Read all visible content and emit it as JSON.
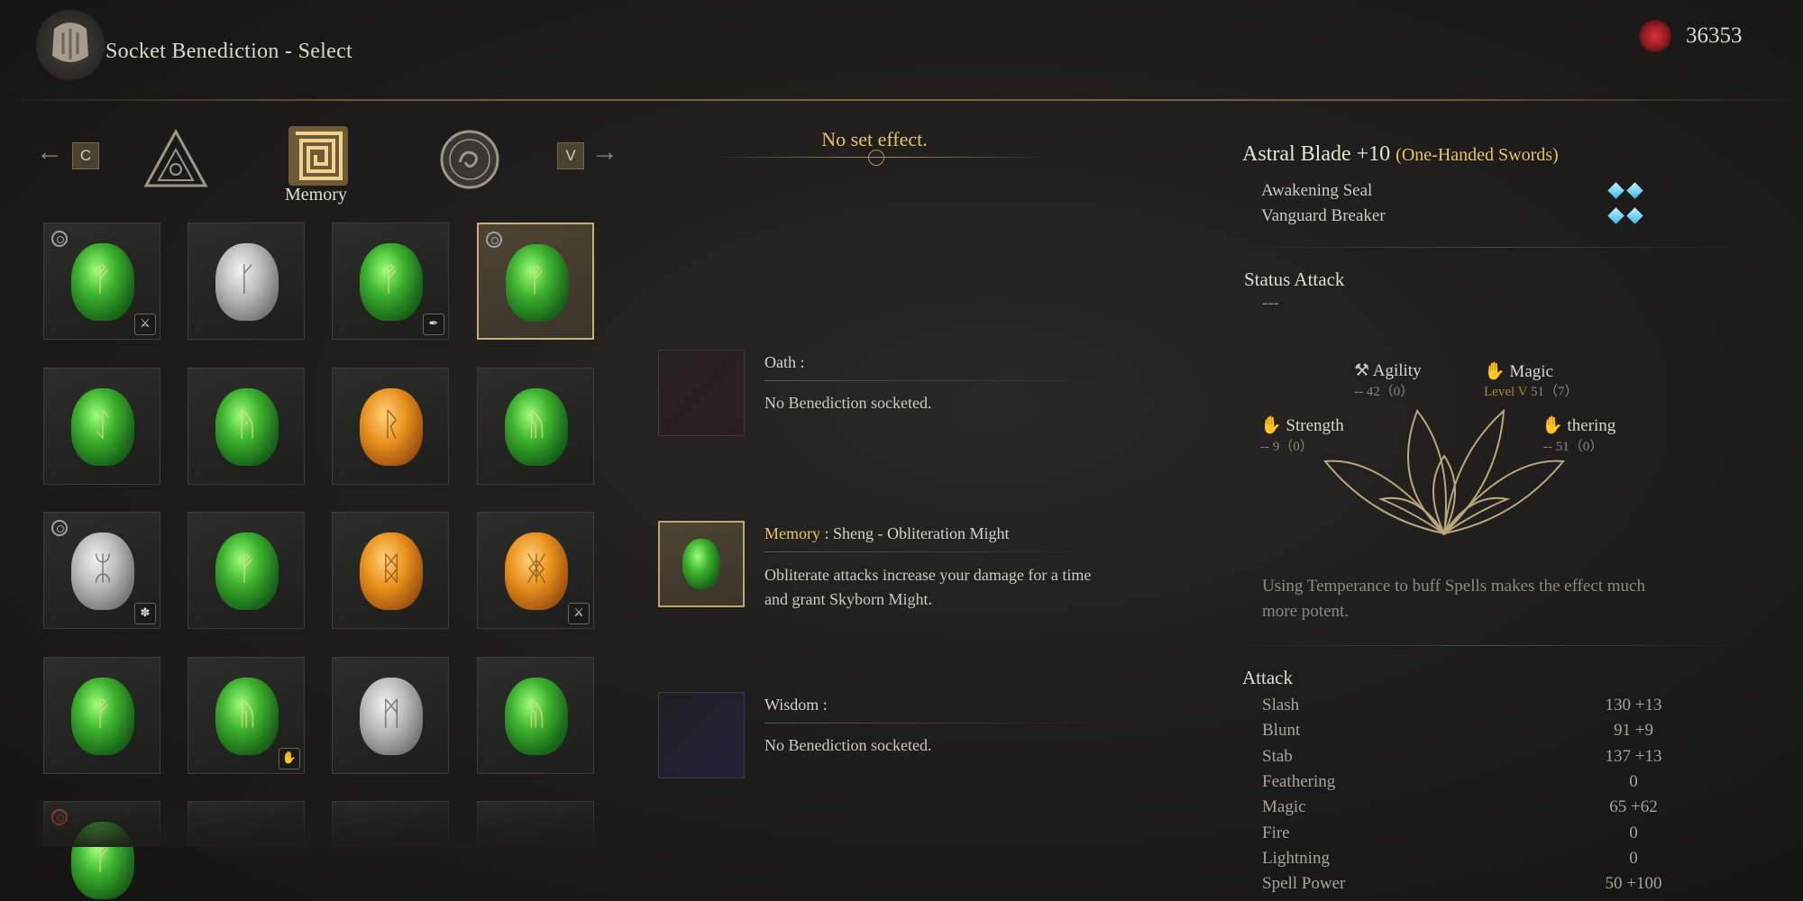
{
  "header": {
    "title": "Socket Benediction - Select",
    "currency_value": "36353",
    "currency_icon": "red-spirit-orb-icon"
  },
  "category_bar": {
    "prev_key": "C",
    "next_key": "V",
    "selected_label": "Memory",
    "categories": [
      "oath-triangle-icon",
      "memory-spiral-icon",
      "wisdom-swirl-icon"
    ]
  },
  "inventory": {
    "slots": [
      {
        "gem": "green",
        "rune": "ᚡ",
        "badge_tl": "blue",
        "badge_br": "weapon-icon"
      },
      {
        "gem": "silver",
        "rune": "ᚴ",
        "badge_tl": "",
        "badge_br": ""
      },
      {
        "gem": "green",
        "rune": "ᚡ",
        "badge_tl": "",
        "badge_br": "feather-icon"
      },
      {
        "gem": "green",
        "rune": "ᚡ",
        "badge_tl": "blue",
        "badge_br": "",
        "selected": true
      },
      {
        "gem": "green",
        "rune": "ᛇ",
        "badge_tl": "",
        "badge_br": ""
      },
      {
        "gem": "green",
        "rune": "ᚤ",
        "badge_tl": "",
        "badge_br": ""
      },
      {
        "gem": "amber",
        "rune": "ᚱ",
        "badge_tl": "",
        "badge_br": ""
      },
      {
        "gem": "green",
        "rune": "ᚥ",
        "badge_tl": "",
        "badge_br": ""
      },
      {
        "gem": "silver",
        "rune": "ᛯ",
        "badge_tl": "blue",
        "badge_br": "gear-icon"
      },
      {
        "gem": "green",
        "rune": "ᚡ",
        "badge_tl": "",
        "badge_br": ""
      },
      {
        "gem": "amber",
        "rune": "ᛥ",
        "badge_tl": "",
        "badge_br": ""
      },
      {
        "gem": "amber",
        "rune": "ᛤ",
        "badge_tl": "",
        "badge_br": "sword-icon"
      },
      {
        "gem": "green",
        "rune": "ᚡ",
        "badge_tl": "",
        "badge_br": ""
      },
      {
        "gem": "green",
        "rune": "ᚥ",
        "badge_tl": "",
        "badge_br": "hand-icon"
      },
      {
        "gem": "silver",
        "rune": "ᛗ",
        "badge_tl": "",
        "badge_br": ""
      },
      {
        "gem": "green",
        "rune": "ᚥ",
        "badge_tl": "",
        "badge_br": ""
      },
      {
        "gem": "green",
        "rune": "ᚡ",
        "badge_tl": "red",
        "badge_br": ""
      },
      {
        "gem": "",
        "rune": "",
        "badge_tl": "",
        "badge_br": ""
      },
      {
        "gem": "",
        "rune": "",
        "badge_tl": "",
        "badge_br": ""
      },
      {
        "gem": "",
        "rune": "",
        "badge_tl": "",
        "badge_br": ""
      }
    ]
  },
  "middle": {
    "set_effect": "No set effect.",
    "oath": {
      "label": "Oath :",
      "text": "No Benediction socketed."
    },
    "memory": {
      "label": "Memory",
      "name": " : Sheng - Obliteration Might",
      "line1": "Obliterate attacks increase your damage for a time",
      "line2": "and grant Skyborn Might."
    },
    "wisdom": {
      "label": "Wisdom :",
      "text": "No Benediction socketed."
    }
  },
  "right": {
    "weapon_name": "Astral Blade +10",
    "weapon_type": "(One-Handed Swords)",
    "abilities": [
      "Awakening Seal",
      "Vanguard Breaker"
    ],
    "status_attack_title": "Status Attack",
    "status_attack_value": "---",
    "stats": {
      "agility": {
        "label": "Agility",
        "sub": "-- 42（0）"
      },
      "magic": {
        "label": "Magic",
        "level": "Level V",
        "sub": " 51（7）"
      },
      "strength": {
        "label": "Strength",
        "sub": "-- 9（0）"
      },
      "thering": {
        "label": "thering",
        "sub": "-- 51（0）"
      }
    },
    "description_line1": "Using Temperance to buff Spells makes the effect much",
    "description_line2": "more potent.",
    "attack_title": "Attack",
    "attack_rows": [
      {
        "label": "Slash",
        "value": "130 +13"
      },
      {
        "label": "Blunt",
        "value": "91 +9"
      },
      {
        "label": "Stab",
        "value": "137 +13"
      },
      {
        "label": "Feathering",
        "value": "0"
      },
      {
        "label": "Magic",
        "value": "65 +62"
      },
      {
        "label": "Fire",
        "value": "0"
      },
      {
        "label": "Lightning",
        "value": "0"
      },
      {
        "label": "Spell Power",
        "value": "50 +100"
      }
    ],
    "accent_color": "#e8c36a",
    "diamond_color": "#3fb6ef"
  }
}
